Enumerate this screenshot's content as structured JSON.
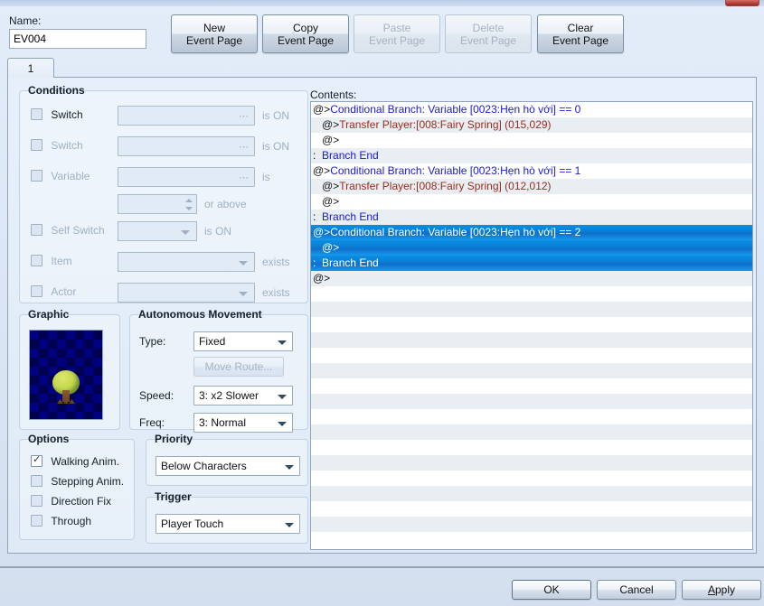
{
  "window": {
    "close_icon": "close-icon"
  },
  "header": {
    "name_label": "Name:",
    "name_value": "EV004",
    "name_placeholder": "",
    "buttons": [
      {
        "line1": "New",
        "line2": "Event Page",
        "enabled": true
      },
      {
        "line1": "Copy",
        "line2": "Event Page",
        "enabled": true
      },
      {
        "line1": "Paste",
        "line2": "Event Page",
        "enabled": false
      },
      {
        "line1": "Delete",
        "line2": "Event Page",
        "enabled": false
      },
      {
        "line1": "Clear",
        "line2": "Event Page",
        "enabled": true
      }
    ]
  },
  "tabs": {
    "items": [
      {
        "label": "1",
        "active": true
      }
    ]
  },
  "conditions": {
    "title": "Conditions",
    "rows": [
      {
        "label": "Switch",
        "checked": false,
        "value": "",
        "suffix": "is ON",
        "widget": "field-ellipsis"
      },
      {
        "label": "Switch",
        "checked": false,
        "value": "",
        "suffix": "is ON",
        "widget": "field-ellipsis"
      },
      {
        "label": "Variable",
        "checked": false,
        "value": "",
        "suffix": "is",
        "widget": "field-ellipsis"
      },
      {
        "label": "",
        "checked": null,
        "value": "",
        "suffix": "or above",
        "widget": "spinner"
      },
      {
        "label": "Self Switch",
        "checked": false,
        "value": "",
        "suffix": "is ON",
        "widget": "combo"
      },
      {
        "label": "Item",
        "checked": false,
        "value": "",
        "suffix": "exists",
        "widget": "combo"
      },
      {
        "label": "Actor",
        "checked": false,
        "value": "",
        "suffix": "exists",
        "widget": "combo"
      }
    ]
  },
  "graphic": {
    "title": "Graphic",
    "sprite_name": "tree-sprite"
  },
  "autonomous": {
    "title": "Autonomous Movement",
    "type_label": "Type:",
    "type_value": "Fixed",
    "move_route_label": "Move Route...",
    "move_route_enabled": false,
    "speed_label": "Speed:",
    "speed_value": "3: x2 Slower",
    "freq_label": "Freq:",
    "freq_value": "3: Normal"
  },
  "options": {
    "title": "Options",
    "items": [
      {
        "label": "Walking Anim.",
        "checked": true
      },
      {
        "label": "Stepping Anim.",
        "checked": false
      },
      {
        "label": "Direction Fix",
        "checked": false
      },
      {
        "label": "Through",
        "checked": false
      }
    ]
  },
  "priority": {
    "title": "Priority",
    "value": "Below Characters"
  },
  "trigger": {
    "title": "Trigger",
    "value": "Player Touch"
  },
  "contents": {
    "label": "Contents:",
    "total_rows": 29,
    "rows": [
      {
        "indent": 0,
        "prefix": "@>",
        "prefix_class": "c-plain",
        "text": "Conditional Branch: Variable [0023:Hẹn hò với] == 0",
        "text_class": "c-cmd",
        "selected": false
      },
      {
        "indent": 1,
        "prefix": "@>",
        "prefix_class": "c-plain",
        "text": "Transfer Player:[008:Fairy Spring] (015,029)",
        "text_class": "c-xfer",
        "selected": false
      },
      {
        "indent": 1,
        "prefix": "@>",
        "prefix_class": "c-plain",
        "text": "",
        "text_class": "c-plain",
        "selected": false
      },
      {
        "indent": 0,
        "prefix": ":",
        "prefix_class": "c-plain",
        "text": "Branch End",
        "text_class": "c-cmd",
        "selected": false
      },
      {
        "indent": 0,
        "prefix": "@>",
        "prefix_class": "c-plain",
        "text": "Conditional Branch: Variable [0023:Hẹn hò với] == 1",
        "text_class": "c-cmd",
        "selected": false
      },
      {
        "indent": 1,
        "prefix": "@>",
        "prefix_class": "c-plain",
        "text": "Transfer Player:[008:Fairy Spring] (012,012)",
        "text_class": "c-xfer",
        "selected": false
      },
      {
        "indent": 1,
        "prefix": "@>",
        "prefix_class": "c-plain",
        "text": "",
        "text_class": "c-plain",
        "selected": false
      },
      {
        "indent": 0,
        "prefix": ":",
        "prefix_class": "c-plain",
        "text": "Branch End",
        "text_class": "c-cmd",
        "selected": false
      },
      {
        "indent": 0,
        "prefix": "@>",
        "prefix_class": "c-plain",
        "text": "Conditional Branch: Variable [0023:Hẹn hò với] == 2",
        "text_class": "c-cmd",
        "selected": true
      },
      {
        "indent": 1,
        "prefix": "@>",
        "prefix_class": "c-plain",
        "text": "",
        "text_class": "c-plain",
        "selected": true
      },
      {
        "indent": 0,
        "prefix": ":",
        "prefix_class": "c-plain",
        "text": "Branch End",
        "text_class": "c-cmd",
        "selected": true
      },
      {
        "indent": 0,
        "prefix": "@>",
        "prefix_class": "c-plain",
        "text": "",
        "text_class": "c-plain",
        "selected": false
      }
    ]
  },
  "footer": {
    "ok_label": "OK",
    "cancel_label": "Cancel",
    "apply_label": "Apply",
    "apply_accel": "A"
  }
}
